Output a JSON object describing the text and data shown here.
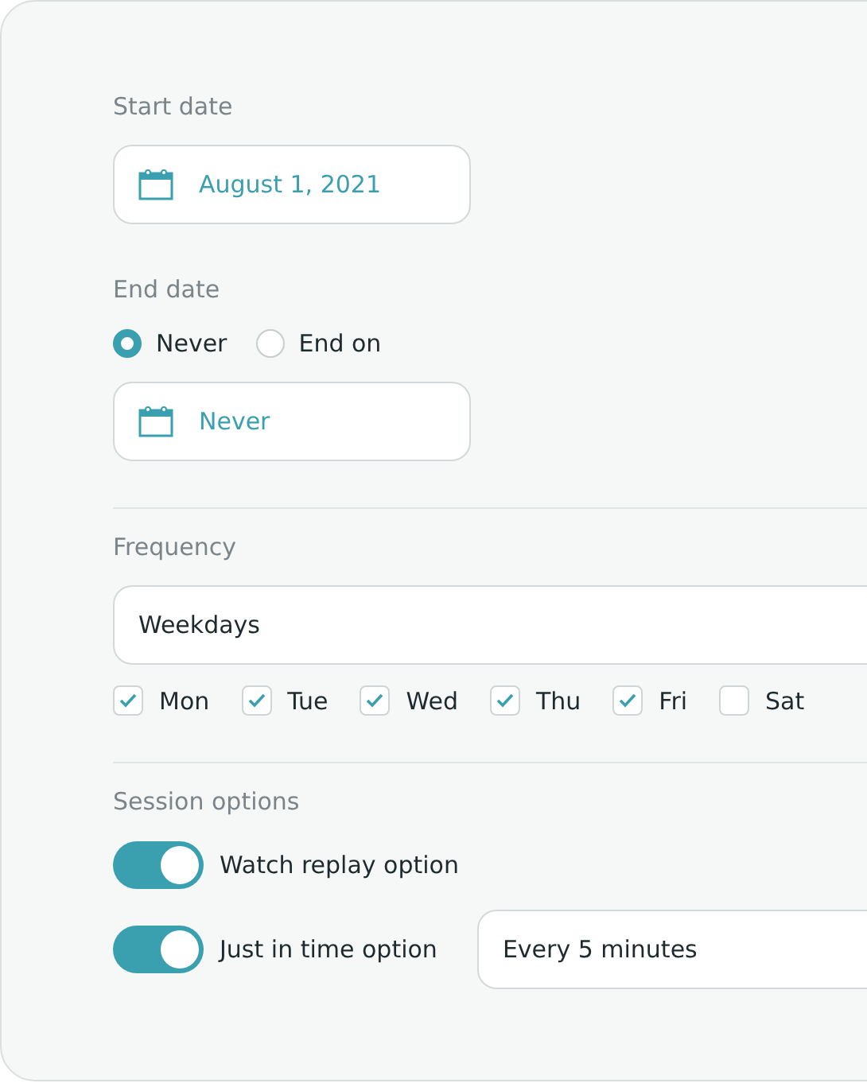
{
  "start_date": {
    "label": "Start date",
    "value": "August 1, 2021"
  },
  "end_date": {
    "label": "End date",
    "options": [
      {
        "label": "Never",
        "selected": true
      },
      {
        "label": "End on",
        "selected": false
      }
    ],
    "value": "Never"
  },
  "frequency": {
    "label": "Frequency",
    "value": "Weekdays",
    "days": [
      {
        "label": "Mon",
        "checked": true
      },
      {
        "label": "Tue",
        "checked": true
      },
      {
        "label": "Wed",
        "checked": true
      },
      {
        "label": "Thu",
        "checked": true
      },
      {
        "label": "Fri",
        "checked": true
      },
      {
        "label": "Sat",
        "checked": false
      }
    ]
  },
  "session_options": {
    "label": "Session options",
    "items": [
      {
        "label": "Watch replay option",
        "on": true
      },
      {
        "label": "Just in time option",
        "on": true,
        "select": "Every 5 minutes"
      }
    ]
  }
}
